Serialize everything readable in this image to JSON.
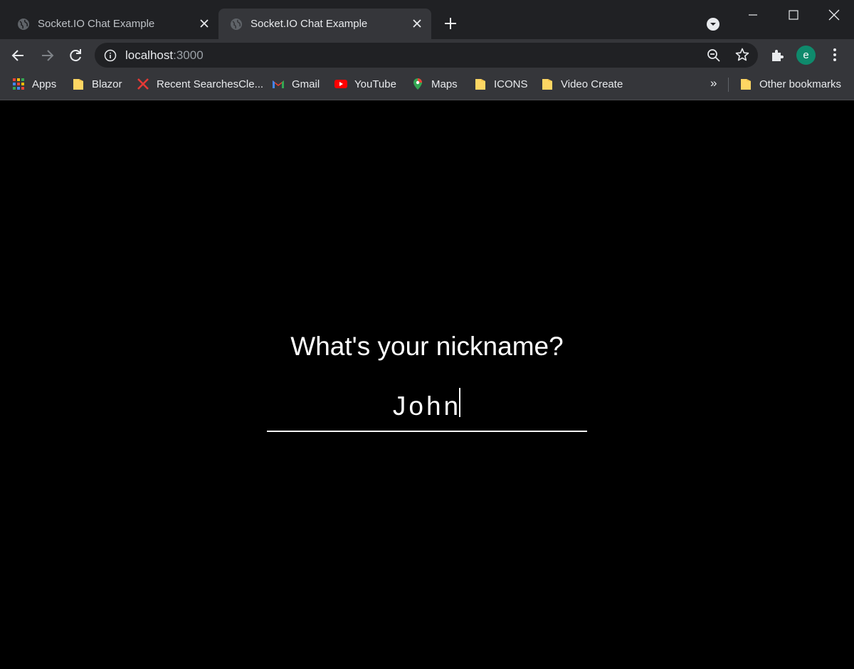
{
  "tabs": [
    {
      "title": "Socket.IO Chat Example",
      "active": false
    },
    {
      "title": "Socket.IO Chat Example",
      "active": true
    }
  ],
  "address": {
    "host": "localhost",
    "port": ":3000"
  },
  "profile": {
    "initial": "e",
    "color": "#0f8a6c"
  },
  "bookmarks": [
    {
      "label": "Apps",
      "icon": "apps-grid-icon"
    },
    {
      "label": "Blazor",
      "icon": "folder-icon"
    },
    {
      "label": "Recent SearchesCle...",
      "icon": "red-x-site-icon"
    },
    {
      "label": "Gmail",
      "icon": "gmail-icon"
    },
    {
      "label": "YouTube",
      "icon": "youtube-icon"
    },
    {
      "label": "Maps",
      "icon": "maps-pin-icon"
    },
    {
      "label": "ICONS",
      "icon": "folder-icon"
    },
    {
      "label": "Video Create",
      "icon": "folder-icon"
    }
  ],
  "bookmarks_more": "»",
  "other_bookmarks": "Other bookmarks",
  "page": {
    "prompt": "What's your nickname?",
    "nickname_value": "John"
  }
}
